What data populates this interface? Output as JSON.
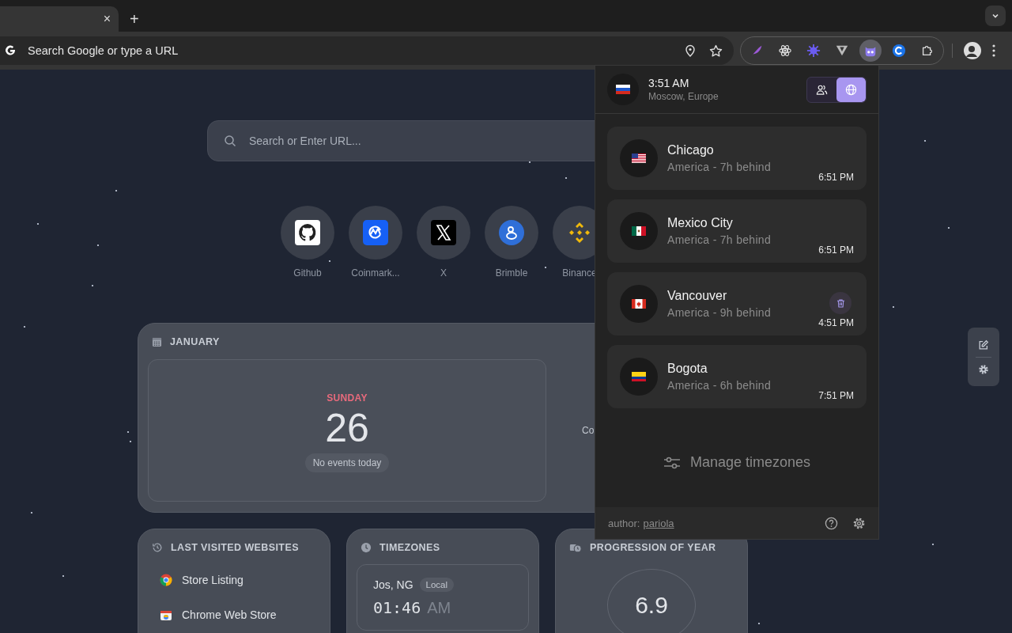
{
  "browser": {
    "tab": {
      "close": "×"
    },
    "new_tab": "+",
    "omnibox": {
      "placeholder": "Search Google or type a URL"
    },
    "extensions": [
      {
        "kind": "feather",
        "selected": false
      },
      {
        "kind": "atom",
        "selected": false
      },
      {
        "kind": "sun",
        "selected": false
      },
      {
        "kind": "v",
        "selected": false
      },
      {
        "kind": "cat",
        "selected": true
      },
      {
        "kind": "c",
        "selected": false
      },
      {
        "kind": "puzzle",
        "selected": false
      }
    ]
  },
  "newtab": {
    "search": {
      "placeholder": "Search or Enter URL..."
    },
    "shortcuts": [
      {
        "label": "Github",
        "kind": "github"
      },
      {
        "label": "Coinmark...",
        "kind": "coin"
      },
      {
        "label": "X",
        "kind": "x"
      },
      {
        "label": "Brimble",
        "kind": "brimble"
      },
      {
        "label": "Binance",
        "kind": "binance"
      }
    ],
    "calendar": {
      "title": "JANUARY",
      "weekday": "SUNDAY",
      "day": "26",
      "events": "No events today",
      "side_text": "Co"
    },
    "last_visited": {
      "title": "LAST VISITED WEBSITES",
      "items": [
        {
          "label": "Store Listing",
          "kind": "chrome"
        },
        {
          "label": "Chrome Web Store",
          "kind": "webstore"
        }
      ]
    },
    "timezones": {
      "title": "TIMEZONES",
      "place": "Jos, NG",
      "badge": "Local",
      "time": "01:46",
      "period": "AM"
    },
    "year_progress": {
      "title": "PROGRESSION OF YEAR",
      "value": "6.9"
    }
  },
  "popup": {
    "current": {
      "kind": "ru",
      "time": "3:51 AM",
      "place": "Moscow, Europe"
    },
    "views": [
      {
        "kind": "people",
        "selected": false
      },
      {
        "kind": "globe",
        "selected": true
      }
    ],
    "zones": [
      {
        "kind": "us",
        "city": "Chicago",
        "offset": "America - 7h behind",
        "time": "6:51 PM",
        "delete_visible": false
      },
      {
        "kind": "mx",
        "city": "Mexico City",
        "offset": "America - 7h behind",
        "time": "6:51 PM",
        "delete_visible": false
      },
      {
        "kind": "ca",
        "city": "Vancouver",
        "offset": "America - 9h behind",
        "time": "4:51 PM",
        "delete_visible": true
      },
      {
        "kind": "co",
        "city": "Bogota",
        "offset": "America - 6h behind",
        "time": "7:51 PM",
        "delete_visible": false
      }
    ],
    "manage": "Manage timezones",
    "author_label": "author:",
    "author": "pariola"
  }
}
